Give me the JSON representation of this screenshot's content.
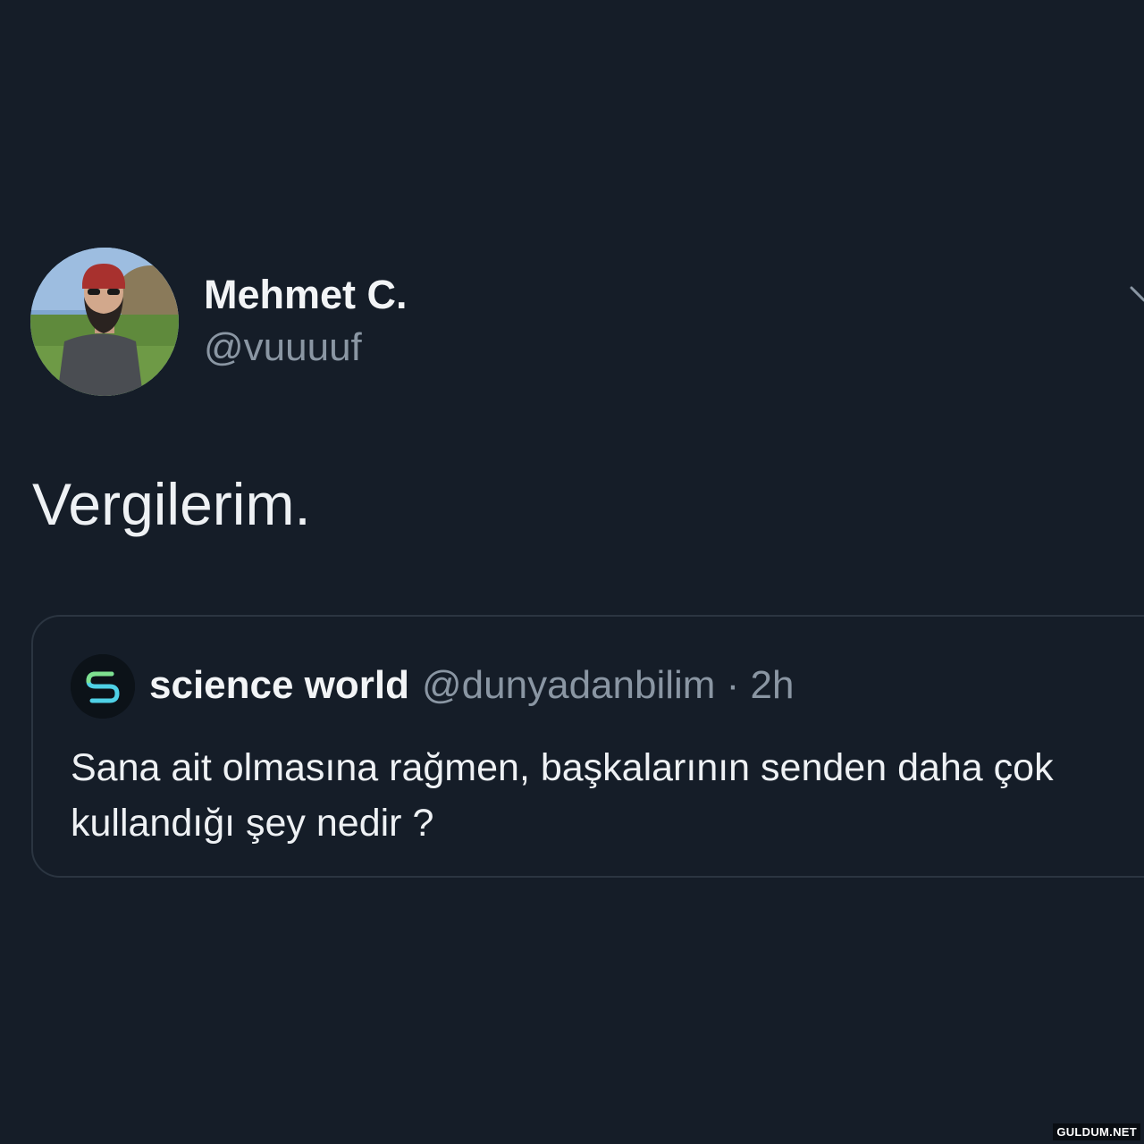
{
  "tweet": {
    "author_name": "Mehmet C.",
    "author_handle": "@vuuuuf",
    "avatar_icon": "user-avatar-photo",
    "more_icon": "chevron-down-icon",
    "text": "Vergilerim."
  },
  "quoted_tweet": {
    "author_name": "science world",
    "author_handle": "@dunyadanbilim",
    "separator": " · ",
    "time": "2h",
    "logo_icon": "science-world-s-logo",
    "text": "Sana ait olmasına rağmen, başkalarının senden daha çok kullandığı şey nedir ?"
  },
  "watermark": "GULDUM.NET",
  "colors": {
    "background": "#151d28",
    "primary_text": "#eef1f4",
    "secondary_text": "#8a96a3",
    "card_border": "#2b3541",
    "logo_accent": "#4fd1e6"
  }
}
